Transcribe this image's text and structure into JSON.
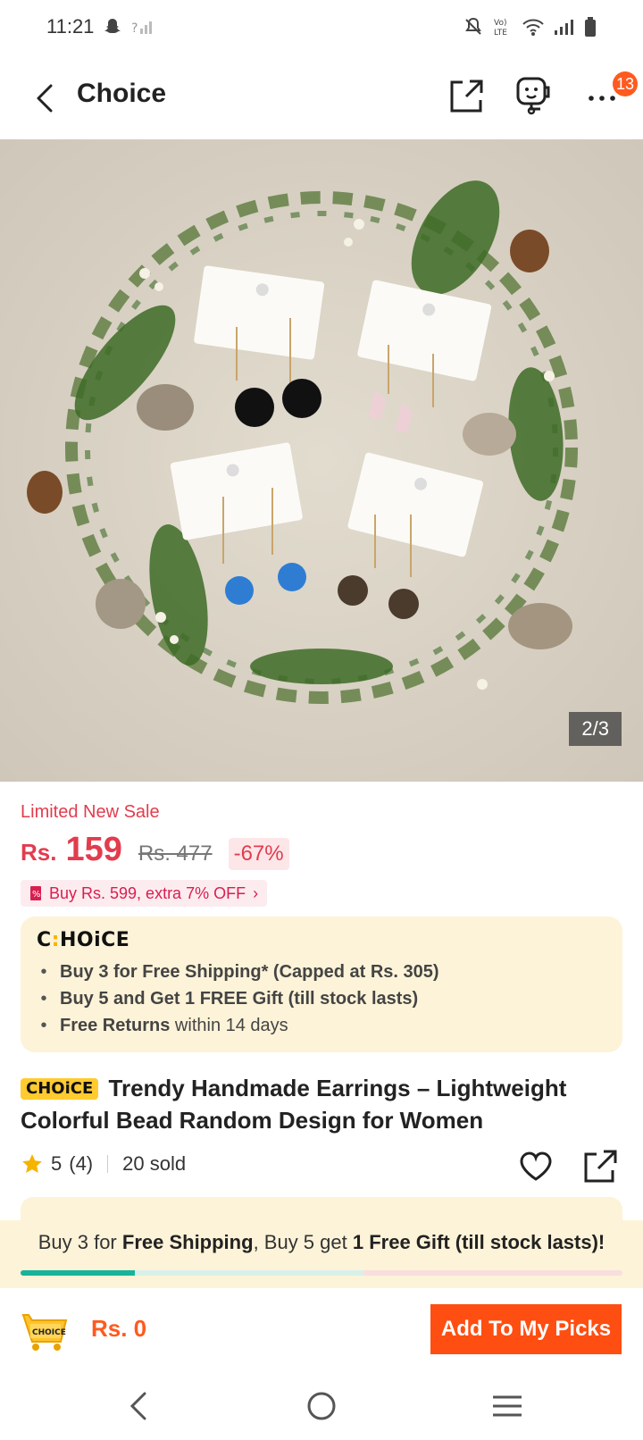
{
  "status_bar": {
    "time": "11:21"
  },
  "header": {
    "title": "Choice",
    "badge_count": "13"
  },
  "hero": {
    "image_counter": "2/3"
  },
  "price": {
    "sale_label": "Limited New Sale",
    "currency": "Rs.",
    "current": "159",
    "original": "Rs. 477",
    "discount": "-67%"
  },
  "promo_chip": {
    "text": "Buy Rs. 599, extra 7% OFF"
  },
  "choice_box": {
    "logo_left": "C",
    "logo_right": "HOiCE",
    "items": [
      {
        "bold": "Buy 3 for  Free Shipping* (Capped at Rs. 305)",
        "normal": ""
      },
      {
        "bold": "Buy 5 and Get 1 FREE Gift (till stock lasts)",
        "normal": ""
      },
      {
        "bold": "Free Returns",
        "normal": " within 14 days"
      }
    ]
  },
  "product": {
    "tag": "CHOiCE",
    "title": "Trendy Handmade Earrings – Lightweight Colorful Bead Random Design for Women",
    "rating": "5",
    "reviews": "(4)",
    "sold": "20 sold"
  },
  "bottom_promo": {
    "part1": "Buy 3 for ",
    "bold1": "Free Shipping",
    "part2": ", Buy 5 get ",
    "bold2": "1 Free Gift (till stock lasts)!",
    "progress_fraction": 0.19
  },
  "action_bar": {
    "cart_label": "CHOICE",
    "total": "Rs. 0",
    "add_button": "Add To My Picks"
  },
  "colors": {
    "accent": "#ff4e11",
    "sale": "#e23c4e",
    "choice_bg": "#fdf3d8",
    "progress": "#17b39a"
  }
}
